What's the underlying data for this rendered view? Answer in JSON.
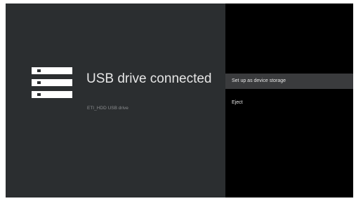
{
  "left": {
    "icon": "storage-drive-icon",
    "title": "USB drive connected",
    "subtitle": "ETI_HDD USB drive"
  },
  "menu": {
    "items": [
      {
        "label": "Set up as device storage",
        "selected": true
      },
      {
        "label": "Eject",
        "selected": false
      }
    ]
  },
  "colors": {
    "left_background": "#2b2e30",
    "right_background": "#000000",
    "selected_item_background": "#3a3b3d",
    "text_primary": "#e6e6e6",
    "text_secondary": "#8b8d8f"
  }
}
